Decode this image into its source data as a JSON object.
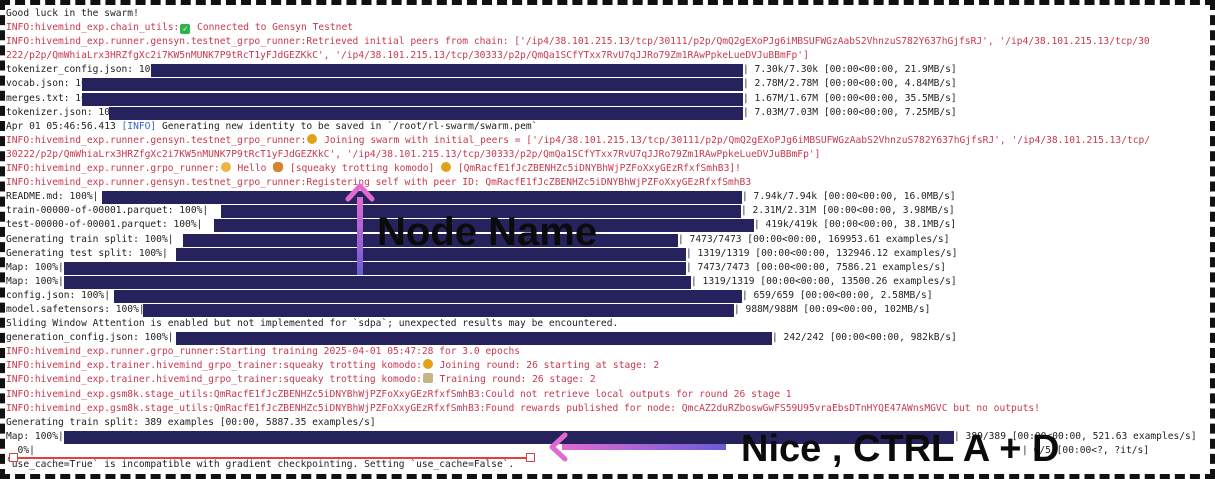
{
  "terminal": {
    "lines": [
      {
        "text": "Good luck in the swarm!",
        "style": "plain"
      },
      {
        "pre": "INFO:hivemind_exp.chain_utils:",
        "icon": "check-icon",
        "post": " Connected to Gensyn Testnet",
        "style": "red"
      },
      {
        "text": "INFO:hivemind_exp.runner.gensyn.testnet_grpo_runner:Retrieved initial peers from chain: ['/ip4/38.101.215.13/tcp/30111/p2p/QmQ2gEXoPJg6iMBSUFWGzAabS2VhnzuS782Y637hGjfsRJ', '/ip4/38.101.215.13/tcp/30",
        "style": "red"
      },
      {
        "text": "222/p2p/QmWhiaLrx3HRZfgXc2i7KW5nMUNK7P9tRcT1yFJdGEZKkC', '/ip4/38.101.215.13/tcp/30333/p2p/QmQa1SCfYTxx7RvU7qJJRo79Zm1RAwPpkeLueDVJuBBmFp']",
        "style": "red"
      },
      {
        "label": "tokenizer_config.json: 100%|",
        "bar": [
          145,
          737
        ],
        "right": "| 7.30k/7.30k [00:00<00:00, 21.9MB/s]"
      },
      {
        "label": "vocab.json: 100%|",
        "bar": [
          76,
          737
        ],
        "right": "| 2.78M/2.78M [00:00<00:00, 4.84MB/s]"
      },
      {
        "label": "merges.txt: 100%|",
        "bar": [
          76,
          737
        ],
        "right": "| 1.67M/1.67M [00:00<00:00, 35.5MB/s]"
      },
      {
        "label": "tokenizer.json: 100%|",
        "bar": [
          103,
          737
        ],
        "right": "| 7.03M/7.03M [00:00<00:00, 7.25MB/s]"
      },
      {
        "pre": "Apr 01 05:46:56.413 ",
        "tagtext": "[INFO]",
        "post": " Generating new identity to be saved in `/root/rl-swarm/swarm.pem`",
        "style": "mixed"
      },
      {
        "pre": "INFO:hivemind_exp.runner.gensyn.testnet_grpo_runner:",
        "icon": "bee-icon",
        "post": " Joining swarm with initial_peers = ['/ip4/38.101.215.13/tcp/30111/p2p/QmQ2gEXoPJg6iMBSUFWGzAabS2VhnzuS782Y637hGjfsRJ', '/ip4/38.101.215.13/tcp/",
        "style": "red"
      },
      {
        "text": "30222/p2p/QmWhiaLrx3HRZfgXc2i7KW5nMUNK7P9tRcT1yFJdGEZKkC', '/ip4/38.101.215.13/tcp/30333/p2p/QmQa1SCfYTxx7RvU7qJJRo79Zm1RAwPpkeLueDVJuBBmFp']",
        "style": "red"
      },
      {
        "pre": "INFO:hivemind_exp.runner.grpo_runner:",
        "icon": "cat-icon",
        "post": " Hello ",
        "icon2": "tiger-icon",
        "post2": " [squeaky trotting komodo] ",
        "icon3": "bee-icon",
        "post3": " [QmRacfE1fJcZBENHZc5iDNYBhWjPZFoXxyGEzRfxfSmhB3]!",
        "style": "red"
      },
      {
        "text": "INFO:hivemind_exp.runner.gensyn.testnet_grpo_runner:Registering self with peer ID: QmRacfE1fJcZBENHZc5iDNYBhWjPZFoXxyGEzRfxfSmhB3",
        "style": "red"
      },
      {
        "label": "README.md: 100%|",
        "bar": [
          96,
          736
        ],
        "right": "| 7.94k/7.94k [00:00<00:00, 16.0MB/s]"
      },
      {
        "label": "train-00000-of-00001.parquet: 100%|",
        "bar": [
          215,
          735
        ],
        "right": "| 2.31M/2.31M [00:00<00:00, 3.98MB/s]"
      },
      {
        "label": "test-00000-of-00001.parquet: 100%|",
        "bar": [
          208,
          748
        ],
        "right": "| 419k/419k [00:00<00:00, 38.1MB/s]"
      },
      {
        "label": "Generating train split: 100%|",
        "bar": [
          177,
          672
        ],
        "right": "| 7473/7473 [00:00<00:00, 169953.61 examples/s]"
      },
      {
        "label": "Generating test split: 100%|",
        "bar": [
          170,
          680
        ],
        "right": "| 1319/1319 [00:00<00:00, 132946.12 examples/s]"
      },
      {
        "label": "Map: 100%|",
        "bar": [
          58,
          680
        ],
        "right": "| 7473/7473 [00:00<00:00, 7586.21 examples/s]"
      },
      {
        "label": "Map: 100%|",
        "bar": [
          58,
          685
        ],
        "right": "| 1319/1319 [00:00<00:00, 13500.26 examples/s]"
      },
      {
        "label": "config.json: 100%|",
        "bar": [
          108,
          736
        ],
        "right": "| 659/659 [00:00<00:00, 2.58MB/s]"
      },
      {
        "label": "model.safetensors: 100%|",
        "bar": [
          137,
          728
        ],
        "right": "| 988M/988M [00:09<00:00, 102MB/s]"
      },
      {
        "text": "Sliding Window Attention is enabled but not implemented for `sdpa`; unexpected results may be encountered.",
        "style": "plain"
      },
      {
        "label": "generation_config.json: 100%|",
        "bar": [
          170,
          766
        ],
        "right": "| 242/242 [00:00<00:00, 982kB/s]"
      },
      {
        "text": "INFO:hivemind_exp.runner.grpo_runner:Starting training 2025-04-01 05:47:28 for 3.0 epochs",
        "style": "red"
      },
      {
        "pre": "INFO:hivemind_exp.trainer.hivemind_grpo_trainer:squeaky trotting komodo:",
        "icon": "bee-icon",
        "post": " Joining round: 26 starting at stage: 2",
        "style": "red"
      },
      {
        "pre": "INFO:hivemind_exp.trainer.hivemind_grpo_trainer:squeaky trotting komodo:",
        "icon": "note-icon",
        "post": " Training round: 26 stage: 2",
        "style": "red"
      },
      {
        "text": "INFO:hivemind_exp.gsm8k.stage_utils:QmRacfE1fJcZBENHZc5iDNYBhWjPZFoXxyGEzRfxfSmhB3:Could not retrieve local outputs for round 26 stage 1",
        "style": "red"
      },
      {
        "text": "INFO:hivemind_exp.gsm8k.stage_utils:QmRacfE1fJcZBENHZc5iDNYBhWjPZFoXxyGEzRfxfSmhB3:Found rewards published for node: QmcAZ2duRZboswGwFS59U95vraEbsDTnHYQE47AWnsMGVC but no outputs!",
        "style": "red"
      },
      {
        "text": "Generating train split: 389 examples [00:00, 5887.35 examples/s]",
        "style": "plain"
      },
      {
        "label": "Map: 100%|",
        "bar": [
          58,
          948
        ],
        "right": "| 389/389 [00:00<00:00, 521.63 examples/s]"
      },
      {
        "label": "  0%|",
        "right": "| 0/5 [00:00<?, ?it/s]",
        "rightx": 1016
      },
      {
        "text": "`use_cache=True` is incompatible with gradient checkpointing. Setting `use_cache=False`.",
        "style": "plain"
      }
    ]
  },
  "annotations": {
    "node_name": "Node Name",
    "ctrl": "Nice , CTRL A + D"
  },
  "colors": {
    "arrow": "#e06bd0",
    "bar": "#26225e",
    "info": "#c8394f"
  }
}
